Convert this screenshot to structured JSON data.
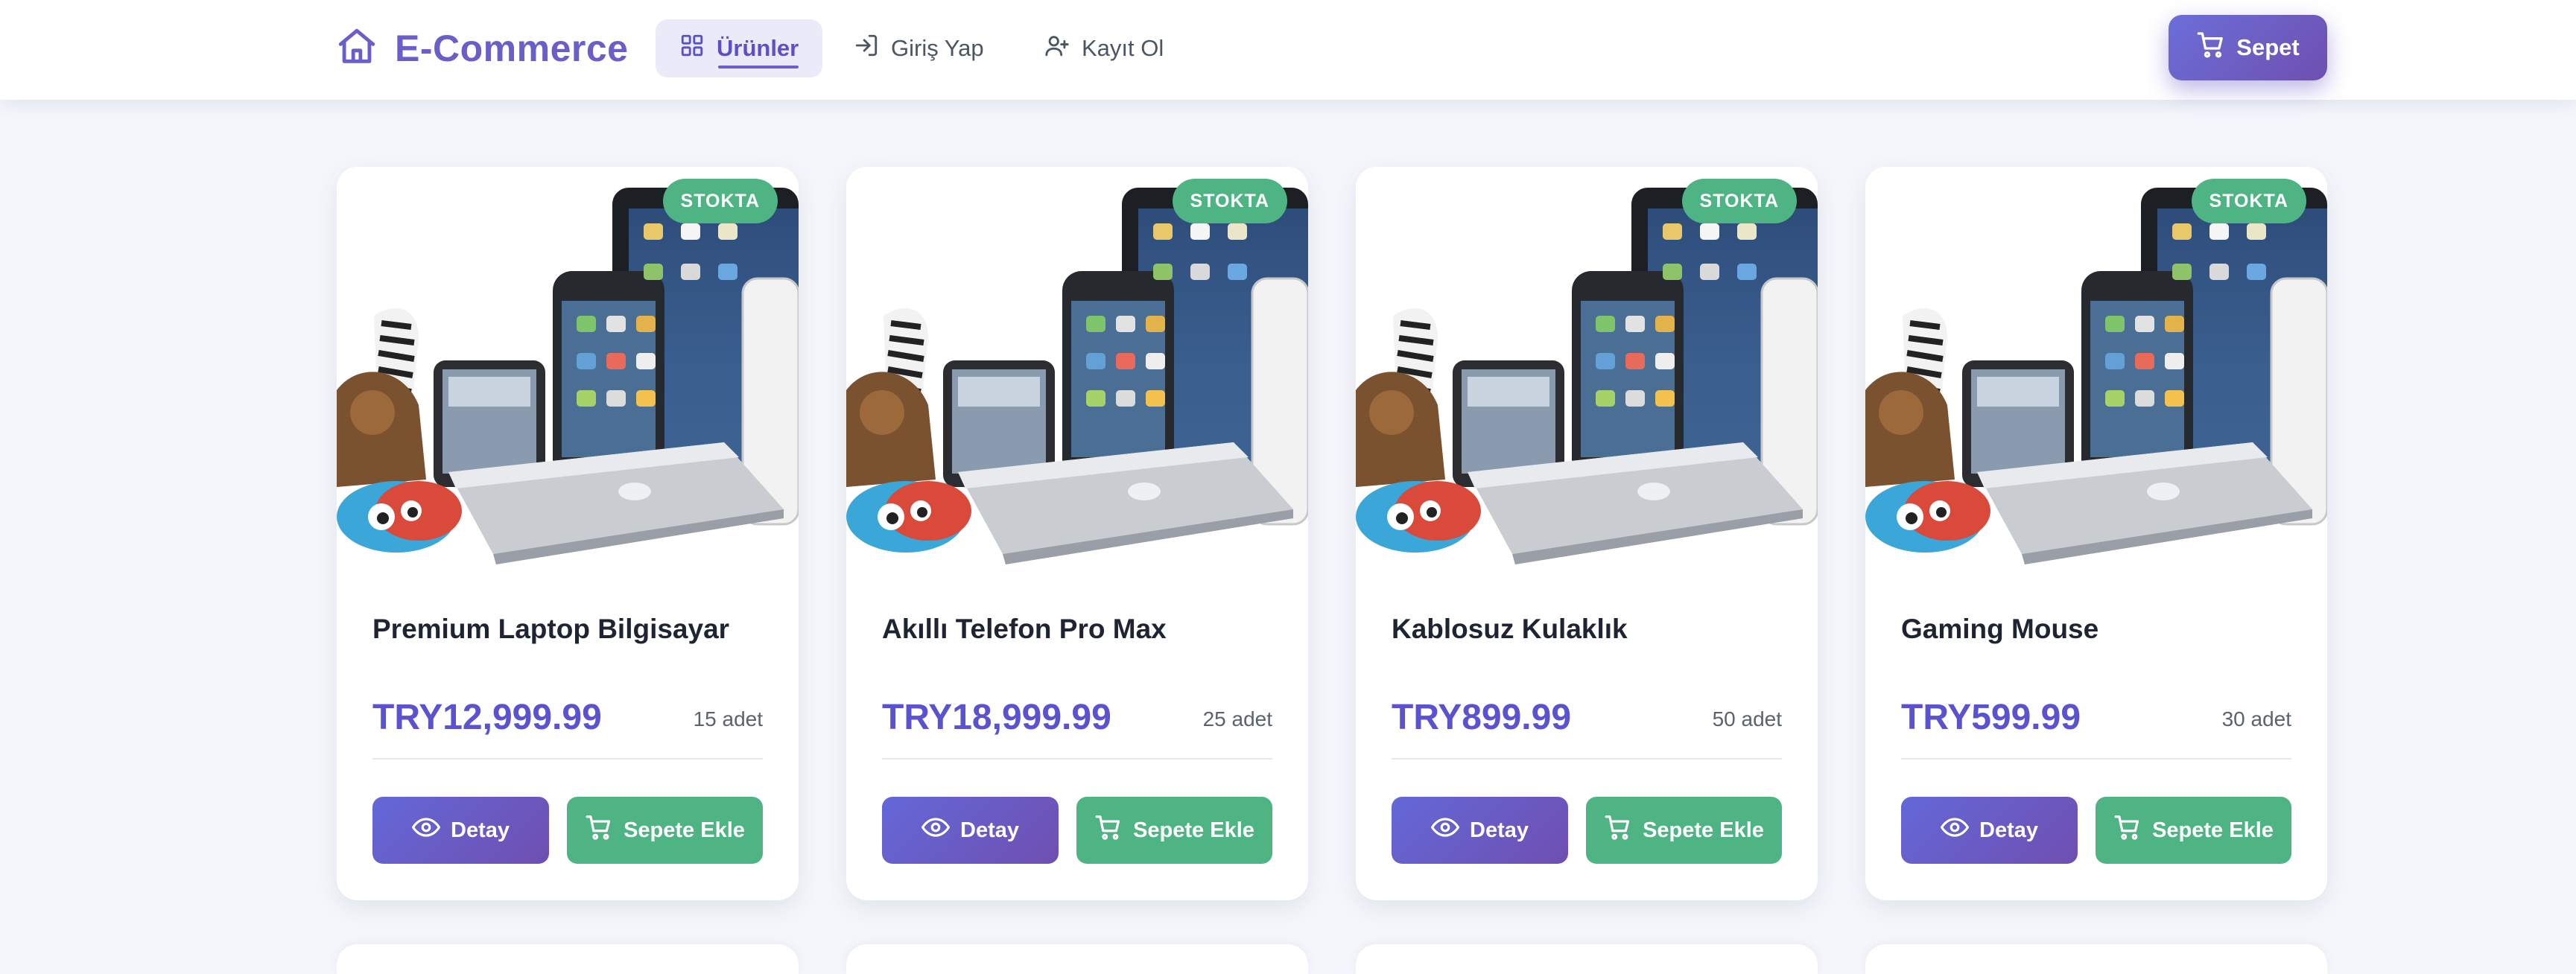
{
  "navbar": {
    "brand": "E-Commerce",
    "links": [
      {
        "label": "Ürünler",
        "icon": "grid-icon",
        "active": true
      },
      {
        "label": "Giriş Yap",
        "icon": "login-icon",
        "active": false
      },
      {
        "label": "Kayıt Ol",
        "icon": "user-plus-icon",
        "active": false
      }
    ],
    "cart_label": "Sepet"
  },
  "colors": {
    "brand": "#6a5ec9",
    "price": "#5a52cf",
    "success": "#4fb483",
    "gradient_start": "#6468d8",
    "gradient_end": "#6f4fb0"
  },
  "products": [
    {
      "name": "Premium Laptop Bilgisayar",
      "price": "TRY12,999.99",
      "stock": "15 adet",
      "badge": "STOKTA",
      "detail_label": "Detay",
      "add_label": "Sepete Ekle"
    },
    {
      "name": "Akıllı Telefon Pro Max",
      "price": "TRY18,999.99",
      "stock": "25 adet",
      "badge": "STOKTA",
      "detail_label": "Detay",
      "add_label": "Sepete Ekle"
    },
    {
      "name": "Kablosuz Kulaklık",
      "price": "TRY899.99",
      "stock": "50 adet",
      "badge": "STOKTA",
      "detail_label": "Detay",
      "add_label": "Sepete Ekle"
    },
    {
      "name": "Gaming Mouse",
      "price": "TRY599.99",
      "stock": "30 adet",
      "badge": "STOKTA",
      "detail_label": "Detay",
      "add_label": "Sepete Ekle"
    }
  ]
}
